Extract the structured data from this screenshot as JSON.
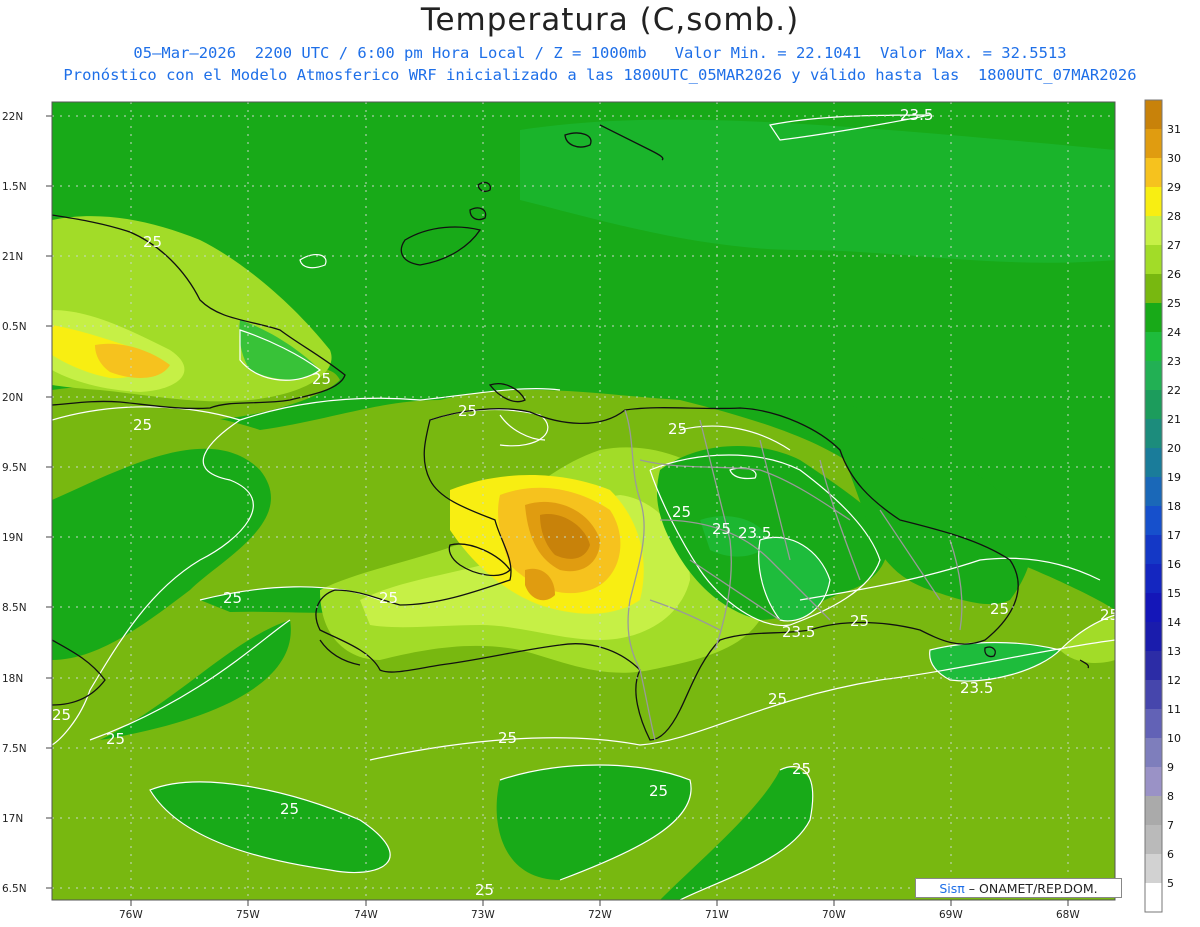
{
  "title": "Temperatura (C,somb.)",
  "subtitle_line1": "05—Mar—2026  2200 UTC / 6:00 pm Hora Local / Z = 1000mb   Valor Min. = 22.1041  Valor Max. = 32.5513",
  "subtitle_line2": "Pronóstico con el Modelo Atmosferico WRF inicializado a las 1800UTC_05MAR2026 y válido hasta las  1800UTC_07MAR2026",
  "credit": {
    "logo": "Sisπ",
    "text": "– ONAMET/REP.DOM."
  },
  "y_ticks": [
    "22N",
    "1.5N",
    "21N",
    "0.5N",
    "20N",
    "9.5N",
    "19N",
    "8.5N",
    "18N",
    "7.5N",
    "17N",
    "6.5N"
  ],
  "x_ticks": [
    "76W",
    "75W",
    "74W",
    "73W",
    "72W",
    "71W",
    "70W",
    "69W",
    "68W"
  ],
  "contour_labels": [
    "23.5",
    "25",
    "25",
    "25",
    "25",
    "25",
    "25",
    "25",
    "25",
    "25",
    "25",
    "23.5",
    "25",
    "23.5",
    "25",
    "25",
    "23.5",
    "25",
    "25",
    "25",
    "25",
    "25",
    "25",
    "25",
    "25"
  ],
  "colorbar": {
    "labels": [
      "31",
      "30",
      "29",
      "28",
      "27",
      "26",
      "25",
      "24",
      "23",
      "22",
      "21",
      "20",
      "19",
      "18",
      "17",
      "16",
      "15",
      "14",
      "13",
      "12",
      "11",
      "10",
      "9",
      "8",
      "7",
      "6",
      "5"
    ],
    "colors": [
      "#c8820a",
      "#e09c10",
      "#f6c21e",
      "#f8ee12",
      "#c6f046",
      "#a2dc28",
      "#78b810",
      "#18aa18",
      "#1ebc3c",
      "#22b054",
      "#1c9c5c",
      "#1c8c7c",
      "#1a7c9a",
      "#1a68b8",
      "#1650cc",
      "#1438c6",
      "#1426c0",
      "#1416b8",
      "#1a1cac",
      "#2c2ca6",
      "#4646ac",
      "#6262b6",
      "#7e7ebc",
      "#9a92c6",
      "#aaaaaa",
      "#bababa",
      "#d2d2d2",
      "#ffffff"
    ]
  },
  "colors": {
    "sea_green": "#18aa18",
    "land_olive": "#78b810",
    "text_blue": "#1e6fe8"
  }
}
